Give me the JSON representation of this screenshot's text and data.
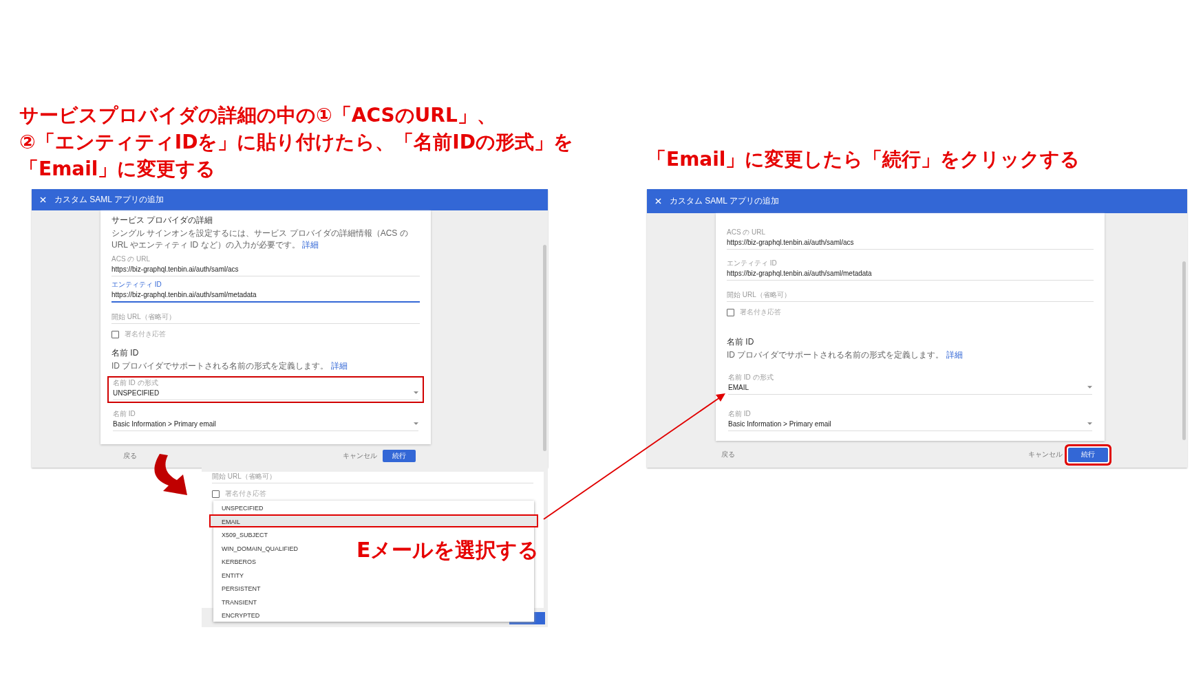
{
  "captions": {
    "left": [
      "サービスプロバイダの詳細の中の①「ACSのURL」、",
      "②「エンティティIDを」に貼り付けたら、「名前IDの形式」を",
      "「Email」に変更する"
    ],
    "right": "「Email」に変更したら「続行」をクリックする",
    "dropdown": "Eメールを選択する"
  },
  "dialogs": [
    {
      "title": "カスタム SAML アプリの追加",
      "section": {
        "title": "サービス プロバイダの詳細",
        "description": "シングル サインオンを設定するには、サービス プロバイダの詳細情報（ACS の URL やエンティティ ID など）の入力が必要です。",
        "link": "詳細"
      },
      "fields": [
        {
          "label": "ACS の URL",
          "value": "https://biz-graphql.tenbin.ai/auth/saml/acs",
          "focused": false
        },
        {
          "label": "エンティティ ID",
          "value": "https://biz-graphql.tenbin.ai/auth/saml/metadata",
          "focused": true
        }
      ],
      "start_url": {
        "placeholder": "開始 URL（省略可）"
      },
      "checkbox": {
        "label": "署名付き応答",
        "checked": false
      },
      "name_id": {
        "title": "名前 ID",
        "description": "ID プロバイダでサポートされる名前の形式を定義します。",
        "link": "詳細"
      },
      "selects": [
        {
          "label": "名前 ID の形式",
          "value": "UNSPECIFIED",
          "highlighted": true
        },
        {
          "label": "名前 ID",
          "value": "Basic Information > Primary email",
          "highlighted": false
        }
      ],
      "footer": {
        "back": "戻る",
        "cancel": "キャンセル",
        "continue": "続行",
        "continue_highlighted": false
      }
    },
    {
      "title": "カスタム SAML アプリの追加",
      "fields": [
        {
          "label": "ACS の URL",
          "value": "https://biz-graphql.tenbin.ai/auth/saml/acs",
          "focused": false
        },
        {
          "label": "エンティティ ID",
          "value": "https://biz-graphql.tenbin.ai/auth/saml/metadata",
          "focused": false
        }
      ],
      "start_url": {
        "placeholder": "開始 URL（省略可）"
      },
      "checkbox": {
        "label": "署名付き応答",
        "checked": false
      },
      "name_id": {
        "title": "名前 ID",
        "description": "ID プロバイダでサポートされる名前の形式を定義します。",
        "link": "詳細"
      },
      "selects": [
        {
          "label": "名前 ID の形式",
          "value": "EMAIL",
          "highlighted": false
        },
        {
          "label": "名前 ID",
          "value": "Basic Information > Primary email",
          "highlighted": false
        }
      ],
      "footer": {
        "back": "戻る",
        "cancel": "キャンセル",
        "continue": "続行",
        "continue_highlighted": true
      }
    }
  ],
  "dropdown_view": {
    "start_url": {
      "placeholder": "開始 URL（省略可）"
    },
    "checkbox": {
      "label": "署名付き応答",
      "checked": false
    },
    "options": [
      {
        "label": "UNSPECIFIED",
        "selected": false,
        "highlighted": false
      },
      {
        "label": "EMAIL",
        "selected": true,
        "highlighted": true
      },
      {
        "label": "X509_SUBJECT",
        "selected": false,
        "highlighted": false
      },
      {
        "label": "WIN_DOMAIN_QUALIFIED",
        "selected": false,
        "highlighted": false
      },
      {
        "label": "KERBEROS",
        "selected": false,
        "highlighted": false
      },
      {
        "label": "ENTITY",
        "selected": false,
        "highlighted": false
      },
      {
        "label": "PERSISTENT",
        "selected": false,
        "highlighted": false
      },
      {
        "label": "TRANSIENT",
        "selected": false,
        "highlighted": false
      },
      {
        "label": "ENCRYPTED",
        "selected": false,
        "highlighted": false
      }
    ]
  }
}
